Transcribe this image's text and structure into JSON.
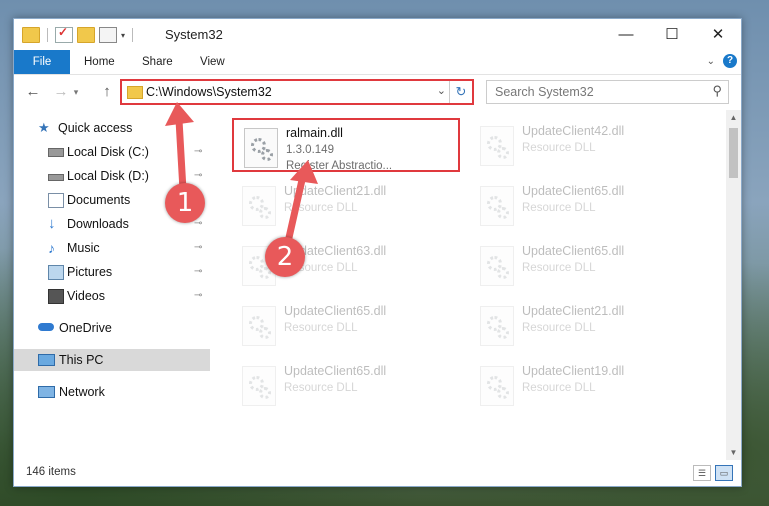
{
  "window": {
    "title": "System32",
    "controls": {
      "minimize": "—",
      "maximize": "☐",
      "close": "✕"
    }
  },
  "ribbon": {
    "tabs": [
      "File",
      "Home",
      "Share",
      "View"
    ],
    "expand_glyph": "⌄",
    "help_glyph": "?"
  },
  "nav": {
    "back_glyph": "←",
    "forward_glyph": "→",
    "recent_glyph": "▾",
    "up_glyph": "↑",
    "address": "C:\\Windows\\System32",
    "address_dropdown_glyph": "⌄",
    "refresh_glyph": "↻",
    "search_placeholder": "Search System32",
    "search_glyph": "⚲"
  },
  "sidebar": {
    "items": [
      {
        "label": "Quick access",
        "icon": "star-icon",
        "pinned": false
      },
      {
        "label": "Local Disk (C:)",
        "icon": "drive-icon",
        "pinned": true
      },
      {
        "label": "Local Disk (D:)",
        "icon": "drive-icon",
        "pinned": true
      },
      {
        "label": "Documents",
        "icon": "documents-icon",
        "pinned": true
      },
      {
        "label": "Downloads",
        "icon": "download-icon",
        "pinned": true
      },
      {
        "label": "Music",
        "icon": "music-icon",
        "pinned": true
      },
      {
        "label": "Pictures",
        "icon": "pictures-icon",
        "pinned": true
      },
      {
        "label": "Videos",
        "icon": "videos-icon",
        "pinned": true
      },
      {
        "label": "OneDrive",
        "icon": "cloud-icon",
        "pinned": false
      },
      {
        "label": "This PC",
        "icon": "pc-icon",
        "pinned": false,
        "selected": true
      },
      {
        "label": "Network",
        "icon": "network-icon",
        "pinned": false
      }
    ],
    "pin_glyph": "📌"
  },
  "files": [
    {
      "name": "ralmain.dll",
      "version": "1.3.0.149",
      "description": "Register Abstractio...",
      "faded": false,
      "highlighted": true
    },
    {
      "name": "UpdateClient42.dll",
      "description": "Resource DLL",
      "faded": true
    },
    {
      "name": "UpdateClient21.dll",
      "description": "Resource DLL",
      "faded": true
    },
    {
      "name": "UpdateClient65.dll",
      "description": "Resource DLL",
      "faded": true
    },
    {
      "name": "UpdateClient63.dll",
      "description": "Resource DLL",
      "faded": true
    },
    {
      "name": "UpdateClient65.dll",
      "description": "Resource DLL",
      "faded": true
    },
    {
      "name": "UpdateClient65.dll",
      "description": "Resource DLL",
      "faded": true
    },
    {
      "name": "UpdateClient21.dll",
      "description": "Resource DLL",
      "faded": true
    },
    {
      "name": "UpdateClient65.dll",
      "description": "Resource DLL",
      "faded": true
    },
    {
      "name": "UpdateClient19.dll",
      "description": "Resource DLL",
      "faded": true
    }
  ],
  "status": {
    "item_count": "146 items"
  },
  "annotations": {
    "marker1": "1",
    "marker2": "2",
    "color": "#e8595a",
    "highlight_color": "#e0393e"
  }
}
